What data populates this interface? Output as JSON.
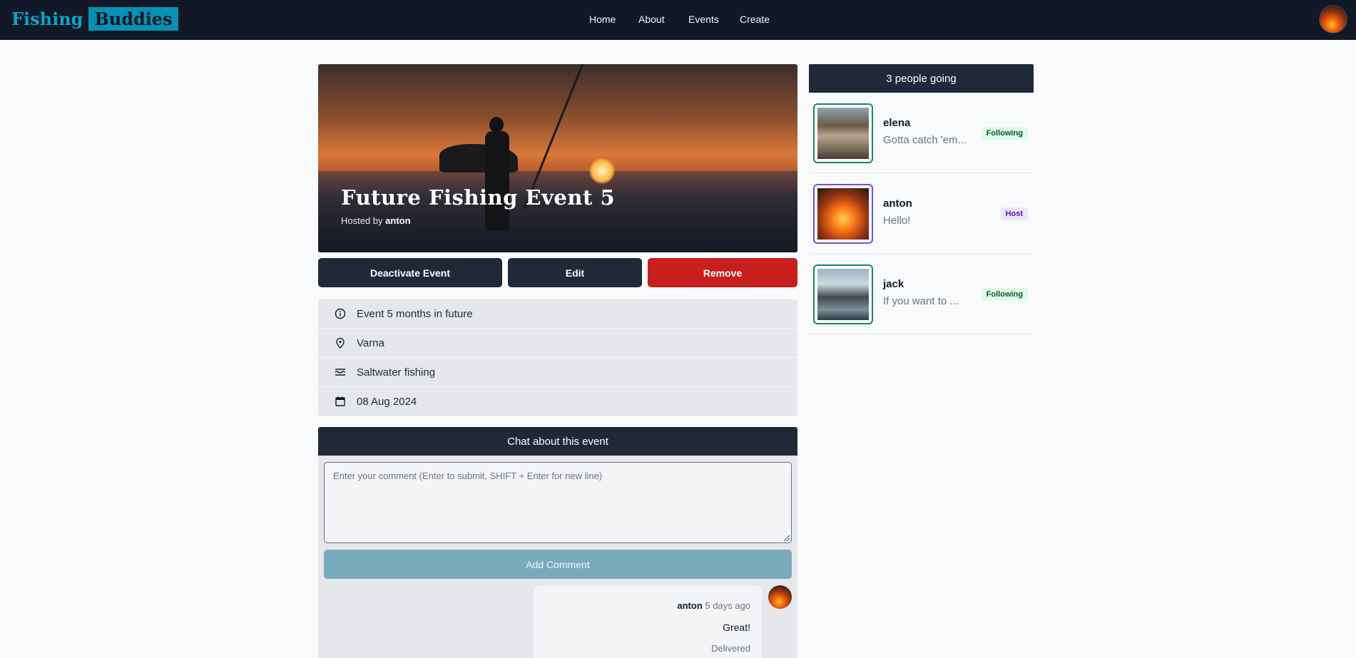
{
  "navbar": {
    "logo_part1": "Fishing",
    "logo_part2": "Buddies",
    "links": [
      "Home",
      "About",
      "Events",
      "Create"
    ],
    "avatar_icon": "user-avatar-icon"
  },
  "event": {
    "title": "Future Fishing Event 5",
    "hosted_by_label": "Hosted by",
    "host_name": "anton"
  },
  "actions": {
    "deactivate": "Deactivate Event",
    "edit": "Edit",
    "remove": "Remove"
  },
  "info": [
    {
      "icon": "info-icon",
      "text": "Event 5 months in future"
    },
    {
      "icon": "location-pin-icon",
      "text": "Varna"
    },
    {
      "icon": "waves-icon",
      "text": "Saltwater fishing"
    },
    {
      "icon": "calendar-icon",
      "text": "08 Aug 2024"
    }
  ],
  "chat": {
    "title": "Chat about this event",
    "placeholder": "Enter your comment (Enter to submit, SHIFT + Enter for new line)",
    "value": "",
    "submit_label": "Add Comment",
    "comments": [
      {
        "author": "anton",
        "time": "5 days ago",
        "text": "Great!",
        "status": "Delivered"
      }
    ]
  },
  "attendees": {
    "title": "3 people going",
    "people": [
      {
        "name": "elena",
        "bio": "Gotta catch 'em...",
        "badge": "Following",
        "role": "follower"
      },
      {
        "name": "anton",
        "bio": "Hello!",
        "badge": "Host",
        "role": "host"
      },
      {
        "name": "jack",
        "bio": "If you want to ...",
        "badge": "Following",
        "role": "follower"
      }
    ]
  },
  "colors": {
    "nav_bg": "#111827",
    "brand": "#0891b2",
    "danger": "#c81e1e",
    "follow_border": "#0f8a64",
    "host_border": "#7c4dc9"
  }
}
